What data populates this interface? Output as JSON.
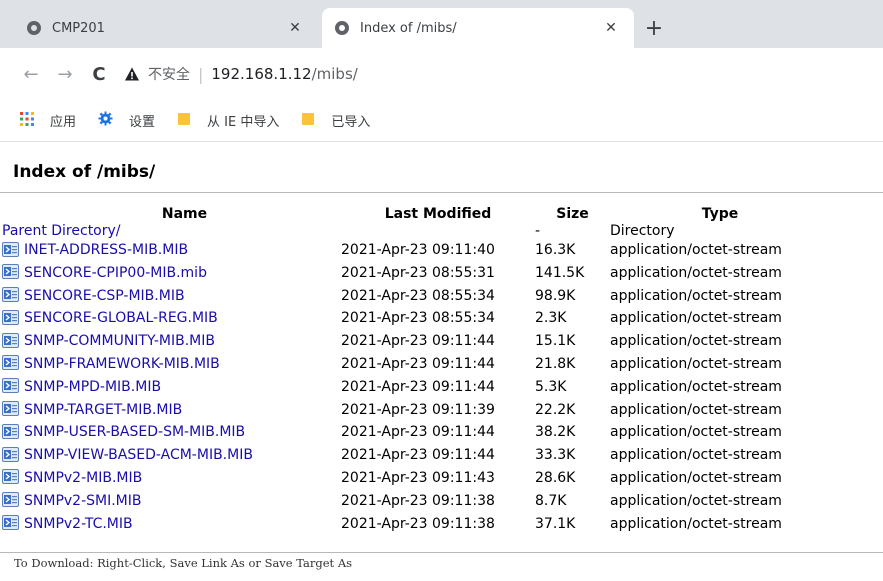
{
  "tabs": [
    {
      "title": "CMP201",
      "active": false
    },
    {
      "title": "Index of /mibs/",
      "active": true
    }
  ],
  "toolbar": {
    "insecure_label": "不安全",
    "url_host": "192.168.1.12",
    "url_path": "/mibs/"
  },
  "bookmarks": [
    {
      "label": "应用",
      "icon": "apps-grid-icon"
    },
    {
      "label": "设置",
      "icon": "gear-icon"
    },
    {
      "label": "从 IE 中导入",
      "icon": "folder-icon"
    },
    {
      "label": "已导入",
      "icon": "folder-icon"
    }
  ],
  "page": {
    "title": "Index of /mibs/",
    "columns": {
      "name": "Name",
      "modified": "Last Modified",
      "size": "Size",
      "type": "Type"
    },
    "parent": {
      "name": "Parent Directory/",
      "modified": "",
      "size": "-",
      "type": "Directory"
    },
    "files": [
      {
        "name": "INET-ADDRESS-MIB.MIB",
        "modified": "2021-Apr-23 09:11:40",
        "size": "16.3K",
        "type": "application/octet-stream"
      },
      {
        "name": "SENCORE-CPIP00-MIB.mib",
        "modified": "2021-Apr-23 08:55:31",
        "size": "141.5K",
        "type": "application/octet-stream"
      },
      {
        "name": "SENCORE-CSP-MIB.MIB",
        "modified": "2021-Apr-23 08:55:34",
        "size": "98.9K",
        "type": "application/octet-stream"
      },
      {
        "name": "SENCORE-GLOBAL-REG.MIB",
        "modified": "2021-Apr-23 08:55:34",
        "size": "2.3K",
        "type": "application/octet-stream"
      },
      {
        "name": "SNMP-COMMUNITY-MIB.MIB",
        "modified": "2021-Apr-23 09:11:44",
        "size": "15.1K",
        "type": "application/octet-stream"
      },
      {
        "name": "SNMP-FRAMEWORK-MIB.MIB",
        "modified": "2021-Apr-23 09:11:44",
        "size": "21.8K",
        "type": "application/octet-stream"
      },
      {
        "name": "SNMP-MPD-MIB.MIB",
        "modified": "2021-Apr-23 09:11:44",
        "size": "5.3K",
        "type": "application/octet-stream"
      },
      {
        "name": "SNMP-TARGET-MIB.MIB",
        "modified": "2021-Apr-23 09:11:39",
        "size": "22.2K",
        "type": "application/octet-stream"
      },
      {
        "name": "SNMP-USER-BASED-SM-MIB.MIB",
        "modified": "2021-Apr-23 09:11:44",
        "size": "38.2K",
        "type": "application/octet-stream"
      },
      {
        "name": "SNMP-VIEW-BASED-ACM-MIB.MIB",
        "modified": "2021-Apr-23 09:11:44",
        "size": "33.3K",
        "type": "application/octet-stream"
      },
      {
        "name": "SNMPv2-MIB.MIB",
        "modified": "2021-Apr-23 09:11:43",
        "size": "28.6K",
        "type": "application/octet-stream"
      },
      {
        "name": "SNMPv2-SMI.MIB",
        "modified": "2021-Apr-23 09:11:38",
        "size": "8.7K",
        "type": "application/octet-stream"
      },
      {
        "name": "SNMPv2-TC.MIB",
        "modified": "2021-Apr-23 09:11:38",
        "size": "37.1K",
        "type": "application/octet-stream"
      }
    ],
    "footer": "To Download: Right-Click, Save Link As or Save Target As"
  },
  "colors": {
    "link": "#1a0dab",
    "tabstrip": "#dee1e6",
    "folder": "#f9c33c"
  }
}
